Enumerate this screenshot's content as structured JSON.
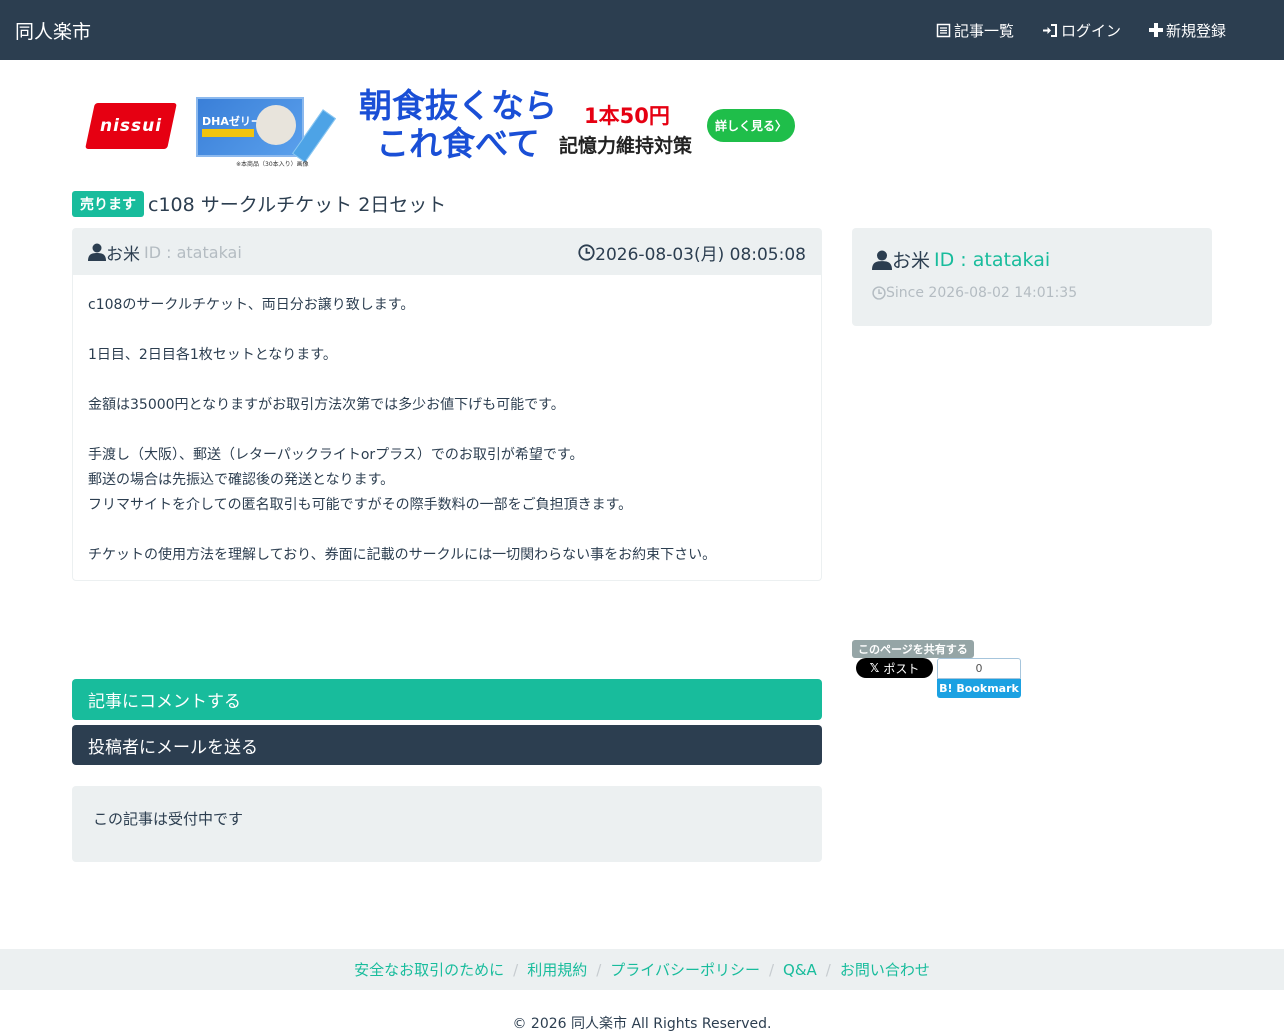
{
  "navbar": {
    "brand": "同人楽市",
    "items": [
      {
        "label": "記事一覧",
        "icon": "list-icon"
      },
      {
        "label": "ログイン",
        "icon": "login-icon"
      },
      {
        "label": "新規登録",
        "icon": "plus-icon"
      }
    ]
  },
  "ad": {
    "logo_text": "nissui",
    "product_label": "DHAゼリー",
    "caption": "※本商品（30本入り）画像",
    "headline_1": "朝食抜くなら",
    "headline_2": "これ食べて",
    "price": "1本50円",
    "tagline": "記憶力維持対策",
    "button": "詳しく見る〉"
  },
  "post": {
    "badge": "売ります",
    "title": "c108 サークルチケット 2日セット",
    "user_name": "お米",
    "user_id": "ID : atatakai",
    "date": "2026-08-03(月) 08:05:08",
    "body": [
      "c108のサークルチケット、両日分お譲り致します。",
      "",
      "1日目、2日目各1枚セットとなります。",
      "",
      "金額は35000円となりますがお取引方法次第では多少お値下げも可能です。",
      "",
      "手渡し（大阪）、郵送（レターパックライトorプラス）でのお取引が希望です。",
      "郵送の場合は先振込で確認後の発送となります。",
      "フリマサイトを介しての匿名取引も可能ですがその際手数料の一部をご負担頂きます。",
      "",
      "チケットの使用方法を理解しており、券面に記載のサークルには一切関わらない事をお約束下さい。"
    ]
  },
  "sidebar": {
    "user_name": "お米",
    "user_id": "ID : atatakai",
    "since": "Since 2026-08-02 14:01:35"
  },
  "share": {
    "label": "このページを共有する",
    "x_label": "ポスト",
    "hatena_count": "0",
    "hatena_label": "B! Bookmark"
  },
  "actions": {
    "comment": "記事にコメントする",
    "mail": "投稿者にメールを送る",
    "status": "この記事は受付中です"
  },
  "footer": {
    "links": [
      "安全なお取引のために",
      "利用規約",
      "プライバシーポリシー",
      "Q&A",
      "お問い合わせ"
    ],
    "copyright": "© 2026 同人楽市 All Rights Reserved."
  },
  "colors": {
    "navbar": "#2c3e50",
    "accent": "#18bc9c",
    "panel_bg": "#ecf0f1",
    "muted": "#b4bcc2"
  }
}
